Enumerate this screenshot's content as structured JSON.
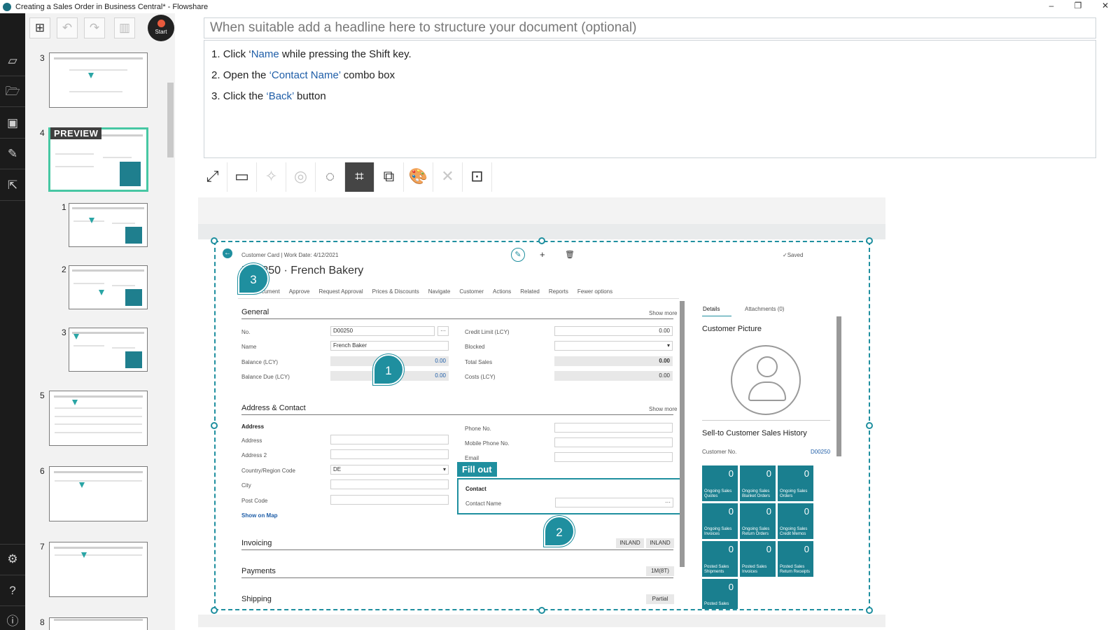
{
  "window": {
    "title": "Creating a Sales Order in Business Central* - Flowshare",
    "minimize": "–",
    "restore": "❐",
    "close": "✕"
  },
  "toolbar_top": {
    "start_label": "Start"
  },
  "thumbnails": {
    "preview_tag": "PREVIEW",
    "items": [
      {
        "num": "3"
      },
      {
        "num": "4"
      },
      {
        "num": "1"
      },
      {
        "num": "2"
      },
      {
        "num": "3"
      },
      {
        "num": "5"
      },
      {
        "num": "6"
      },
      {
        "num": "7"
      },
      {
        "num": "8"
      }
    ]
  },
  "editor": {
    "headline_placeholder": "When suitable add a headline here to structure your document (optional)",
    "steps": [
      {
        "num": "1.",
        "pre": "Click ‘",
        "hl": "Name",
        "post": " while pressing the Shift key."
      },
      {
        "num": "2.",
        "pre": "Open the ",
        "hl": "‘Contact Name’",
        "post": " combo box"
      },
      {
        "num": "3.",
        "pre": "Click the ",
        "hl": "‘Back’",
        "post": " button"
      }
    ]
  },
  "screenshot": {
    "breadcrumb": "Customer Card | Work Date: 4/12/2021",
    "saved": "✓Saved",
    "title": "D00250 · French Bakery",
    "actions": [
      "New Document",
      "Approve",
      "Request Approval",
      "Prices & Discounts",
      "Navigate",
      "Customer",
      "Actions",
      "Related",
      "Reports",
      "Fewer options"
    ],
    "general": {
      "heading": "General",
      "show_more": "Show more",
      "no_label": "No.",
      "no_value": "D00250",
      "name_label": "Name",
      "name_value": "French Baker",
      "balance_label": "Balance (LCY)",
      "balance_value": "0.00",
      "balance_due_label": "Balance Due (LCY)",
      "balance_due_value": "0.00",
      "credit_label": "Credit Limit (LCY)",
      "credit_value": "0.00",
      "blocked_label": "Blocked",
      "total_sales_label": "Total Sales",
      "total_sales_value": "0.00",
      "costs_label": "Costs (LCY)",
      "costs_value": "0.00"
    },
    "address": {
      "heading": "Address & Contact",
      "show_more": "Show more",
      "sub": "Address",
      "address_label": "Address",
      "address2_label": "Address 2",
      "country_label": "Country/Region Code",
      "country_value": "DE",
      "city_label": "City",
      "post_label": "Post Code",
      "map_link": "Show on Map",
      "phone_label": "Phone No.",
      "mobile_label": "Mobile Phone No.",
      "email_label": "Email",
      "contact_sub": "Contact",
      "contact_name_label": "Contact Name"
    },
    "invoicing": {
      "heading": "Invoicing",
      "v1": "INLAND",
      "v2": "INLAND"
    },
    "payments": {
      "heading": "Payments",
      "v1": "1M(8T)"
    },
    "shipping": {
      "heading": "Shipping",
      "v1": "Partial"
    },
    "factbox": {
      "details_tab": "Details",
      "attachments_tab": "Attachments (0)",
      "picture_heading": "Customer Picture",
      "history_heading": "Sell-to Customer Sales History",
      "customer_no_label": "Customer No.",
      "customer_no_value": "D00250",
      "tiles": [
        {
          "n": "0",
          "l": "Ongoing Sales Quotes"
        },
        {
          "n": "0",
          "l": "Ongoing Sales Blanket Orders"
        },
        {
          "n": "0",
          "l": "Ongoing Sales Orders"
        },
        {
          "n": "0",
          "l": "Ongoing Sales Invoices"
        },
        {
          "n": "0",
          "l": "Ongoing Sales Return Orders"
        },
        {
          "n": "0",
          "l": "Ongoing Sales Credit Memos"
        },
        {
          "n": "0",
          "l": "Posted Sales Shipments"
        },
        {
          "n": "0",
          "l": "Posted Sales Invoices"
        },
        {
          "n": "0",
          "l": "Posted Sales Return Receipts"
        },
        {
          "n": "0",
          "l": "Posted Sales"
        }
      ]
    },
    "callouts": {
      "b1": "1",
      "b2": "2",
      "b3": "3",
      "fill_out": "Fill out"
    }
  },
  "colors": {
    "accent": "#1f8f9f",
    "active_thumb": "#47c7a3",
    "rail": "#1b1b1b"
  }
}
